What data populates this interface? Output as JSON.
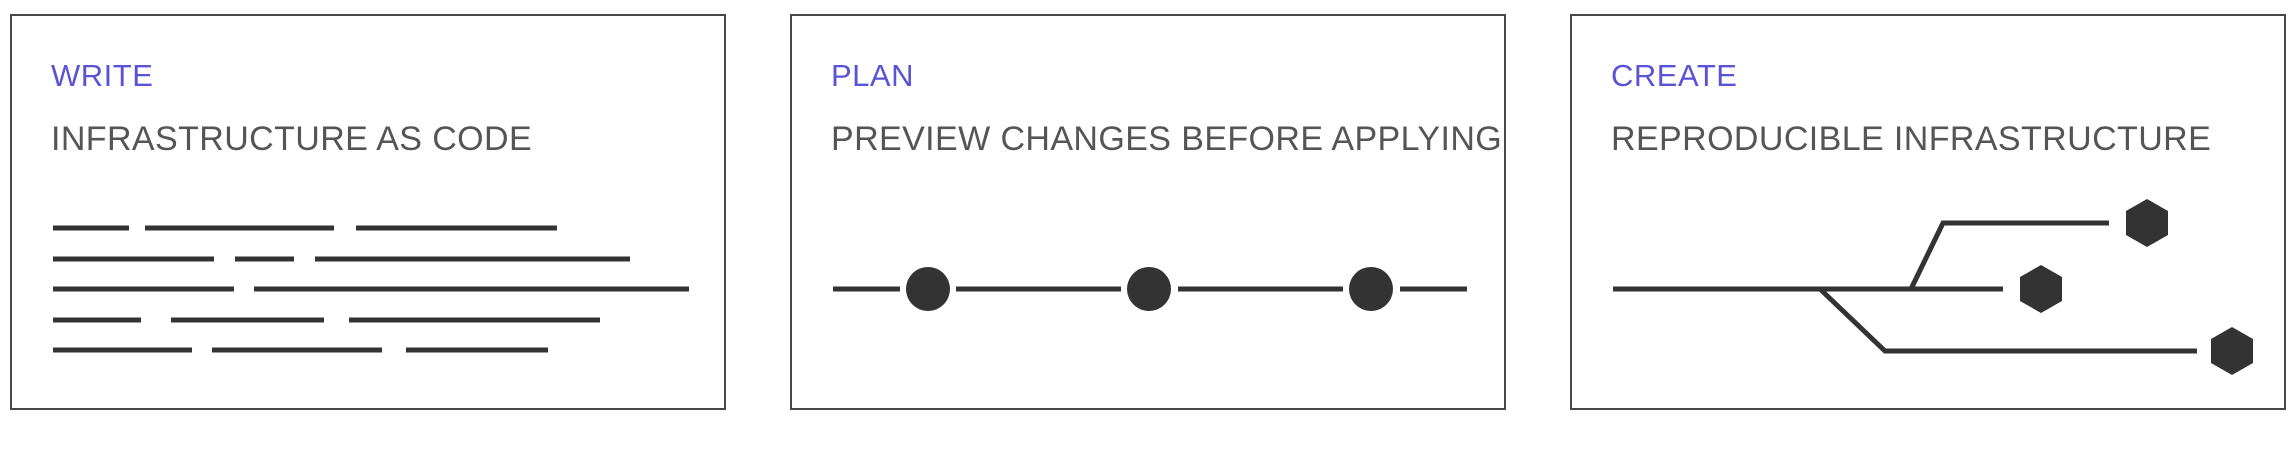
{
  "accent_color": "#5b53d6",
  "cards": [
    {
      "label": "WRITE",
      "title": "INFRASTRUCTURE AS CODE",
      "illustration": "code-lines"
    },
    {
      "label": "PLAN",
      "title": "PREVIEW CHANGES BEFORE APPLYING",
      "illustration": "timeline-with-three-nodes"
    },
    {
      "label": "CREATE",
      "title": "REPRODUCIBLE INFRASTRUCTURE",
      "illustration": "branching-lines-to-hexagons"
    }
  ]
}
